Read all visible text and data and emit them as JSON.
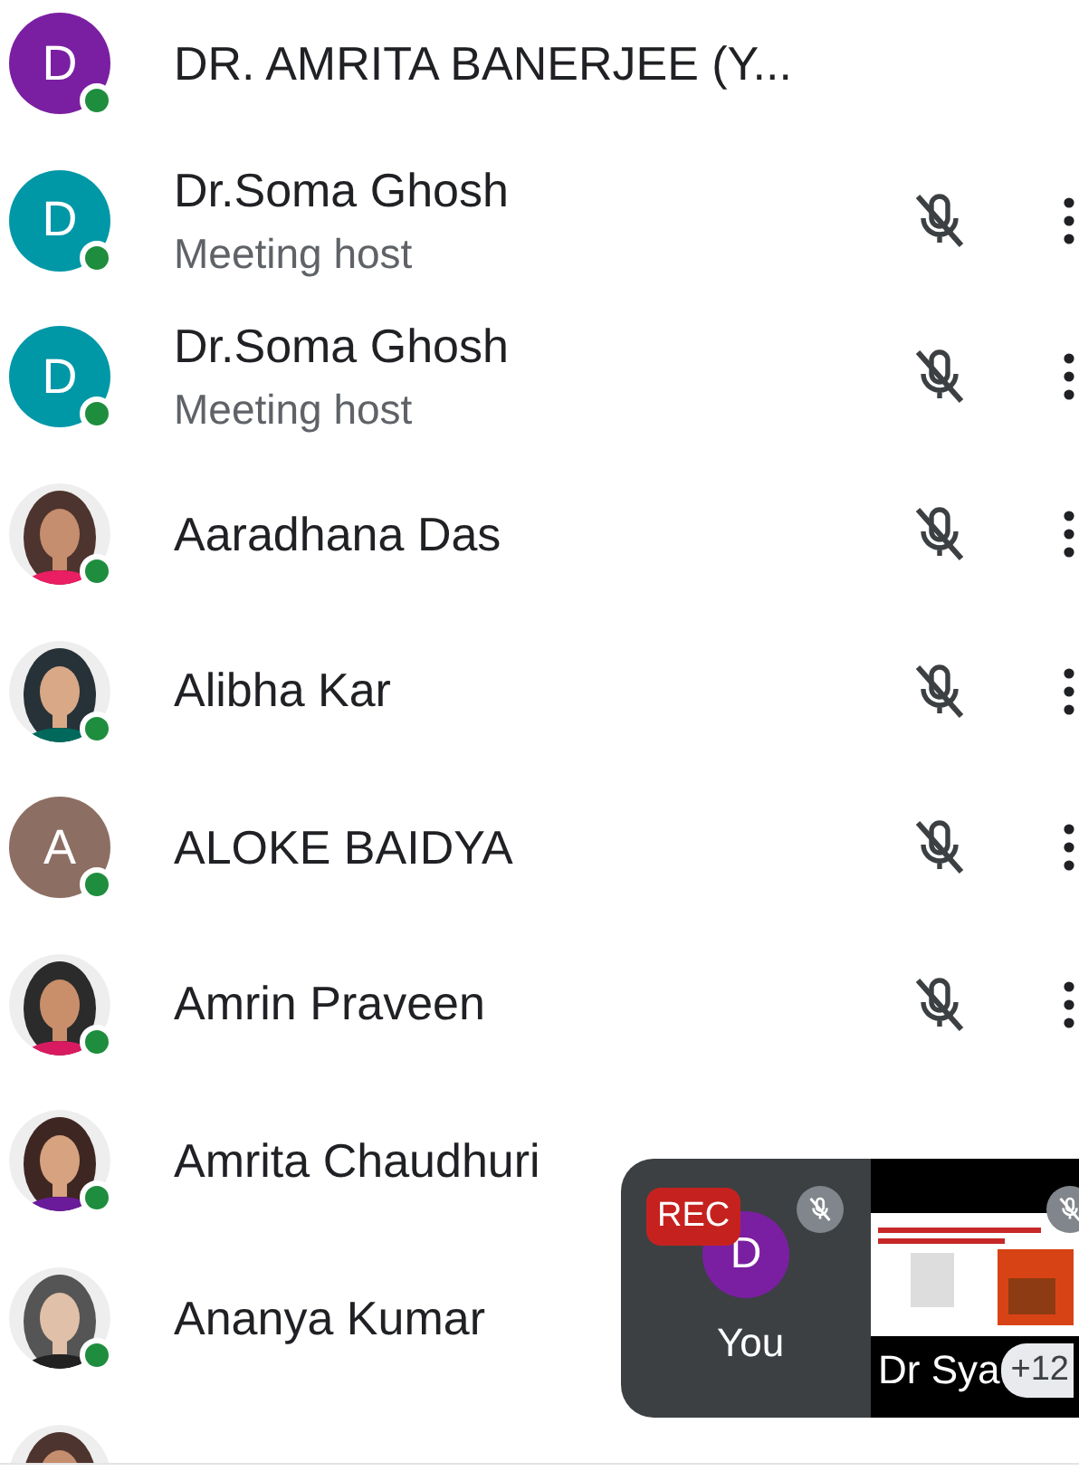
{
  "participants": [
    {
      "kind": "self",
      "name": "DR. AMRITA BANERJEE (Y...",
      "avatar": {
        "kind": "letter",
        "letter": "D",
        "color": "#7b1fa2"
      },
      "online": true
    },
    {
      "kind": "other",
      "name": "Dr.Soma Ghosh",
      "role": "Meeting host",
      "avatar": {
        "kind": "letter",
        "letter": "D",
        "color": "#0097a7"
      },
      "online": true,
      "muted": true
    },
    {
      "kind": "other",
      "name": "Dr.Soma Ghosh",
      "role": "Meeting host",
      "avatar": {
        "kind": "letter",
        "letter": "D",
        "color": "#0097a7"
      },
      "online": true,
      "muted": true
    },
    {
      "kind": "other",
      "name": "Aaradhana Das",
      "online": true,
      "muted": true
    },
    {
      "kind": "other",
      "name": "Alibha Kar",
      "online": true,
      "muted": true
    },
    {
      "kind": "other",
      "name": "ALOKE BAIDYA",
      "avatar": {
        "kind": "letter",
        "letter": "A",
        "color": "#8d6e63"
      },
      "online": true,
      "muted": true
    },
    {
      "kind": "other",
      "name": "Amrin Praveen",
      "online": true,
      "muted": true
    },
    {
      "kind": "covered",
      "name": "Amrita Chaudhuri",
      "online": true
    },
    {
      "kind": "covered",
      "name": "Ananya Kumar",
      "online": true
    },
    {
      "kind": "partial"
    }
  ],
  "self_tile": {
    "recording_label": "REC",
    "avatar_letter": "D",
    "name": "You",
    "muted": true
  },
  "presenter_tile": {
    "name": "Dr Sya",
    "more_count": "+12",
    "muted": true
  }
}
